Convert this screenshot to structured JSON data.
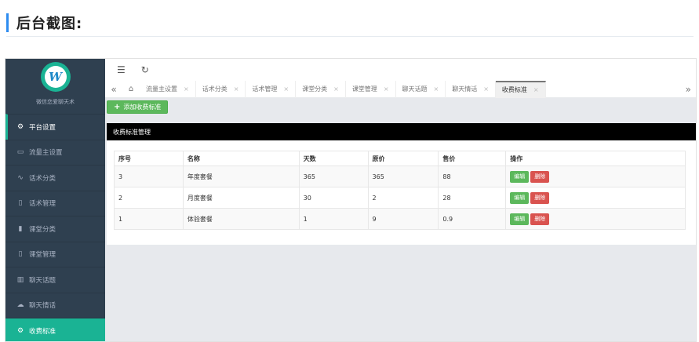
{
  "heading": "后台截图:",
  "brand_name": "微信恋爱聊天术",
  "logo_letter": "W",
  "sidebar": {
    "items": [
      {
        "icon": "gear-icon",
        "glyph": "⚙",
        "label": "平台设置"
      },
      {
        "icon": "video-icon",
        "glyph": "▭",
        "label": "流量主设置"
      },
      {
        "icon": "pulse-icon",
        "glyph": "∿",
        "label": "话术分类"
      },
      {
        "icon": "doc-icon",
        "glyph": "▯",
        "label": "话术管理"
      },
      {
        "icon": "file-icon",
        "glyph": "▮",
        "label": "课堂分类"
      },
      {
        "icon": "doc-icon",
        "glyph": "▯",
        "label": "课堂管理"
      },
      {
        "icon": "book-icon",
        "glyph": "▥",
        "label": "聊天话题"
      },
      {
        "icon": "cloud-icon",
        "glyph": "☁",
        "label": "聊天情话"
      },
      {
        "icon": "gear-icon",
        "glyph": "⚙",
        "label": "收费标准"
      }
    ]
  },
  "topbar": {
    "menu_glyph": "☰",
    "refresh_glyph": "↻"
  },
  "tabs": {
    "prev_glyph": "«",
    "home_glyph": "⌂",
    "next_glyph": "»",
    "close_glyph": "×",
    "items": [
      {
        "label": "流量主设置"
      },
      {
        "label": "话术分类"
      },
      {
        "label": "话术管理"
      },
      {
        "label": "课堂分类"
      },
      {
        "label": "课堂管理"
      },
      {
        "label": "聊天话题"
      },
      {
        "label": "聊天情话"
      },
      {
        "label": "收费标准"
      }
    ],
    "active_index": 7
  },
  "add_button": "添加收费标准",
  "panel_title": "收费标准管理",
  "table": {
    "headers": [
      "序号",
      "名称",
      "天数",
      "原价",
      "售价",
      "操作"
    ],
    "rows": [
      [
        "3",
        "年度套餐",
        "365",
        "365",
        "88"
      ],
      [
        "2",
        "月度套餐",
        "30",
        "2",
        "28"
      ],
      [
        "1",
        "体验套餐",
        "1",
        "9",
        "0.9"
      ]
    ],
    "edit_label": "编辑",
    "delete_label": "删除"
  },
  "colors": {
    "sidebar": "#2f4050",
    "accent": "#1ab394",
    "success": "#5cb85c",
    "danger": "#d9534f"
  }
}
